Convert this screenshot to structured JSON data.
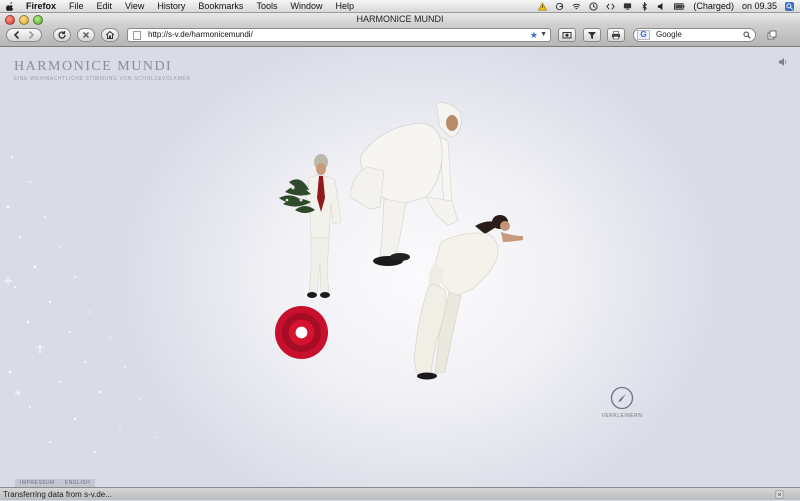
{
  "menubar": {
    "app": "Firefox",
    "items": [
      "File",
      "Edit",
      "View",
      "History",
      "Bookmarks",
      "Tools",
      "Window",
      "Help"
    ],
    "battery": "(Charged)",
    "clock": "on 09.35"
  },
  "window": {
    "title": "HARMONICE MUNDI"
  },
  "toolbar": {
    "url": "http://s-v.de/harmonicemundi/",
    "search_value": "Google"
  },
  "page": {
    "brand_title": "HARMONICE MUNDI",
    "brand_subtitle": "EINE WEIHNACHTLICHE STIMMUNG VON SCHOLZ&VOLKMER",
    "zoom_label": "VERKLEINERN",
    "footer_links": [
      "IMPRESSUM",
      "ENGLISH"
    ]
  },
  "status": {
    "text": "Transferring data from s-v.de..."
  },
  "colors": {
    "accent_red": "#c8102e",
    "brand_text": "#8c8c9a"
  }
}
